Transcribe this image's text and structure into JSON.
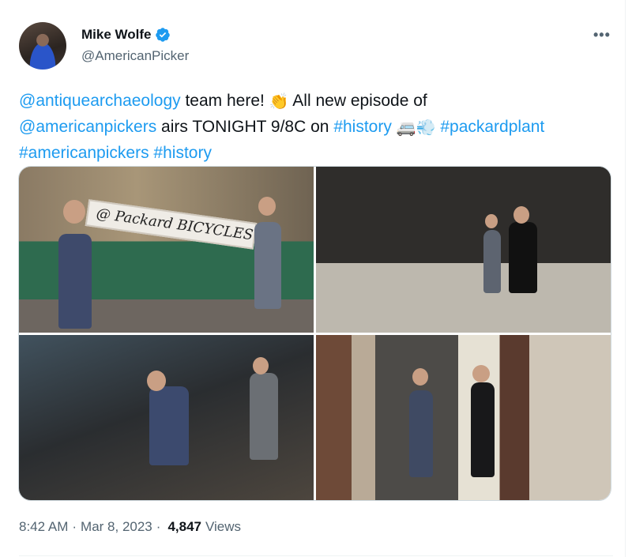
{
  "author": {
    "display_name": "Mike Wolfe",
    "handle": "@AmericanPicker",
    "verified": true
  },
  "menu": {
    "more_label": "•••"
  },
  "tweet": {
    "mention_team": "@antiquearchaeology",
    "text_part1": " team here! ",
    "emoji_clap": "👏",
    "text_part2": " All new episode of",
    "mention_show": "@americanpickers",
    "text_part3": " airs TONIGHT 9/8C on ",
    "hashtag_history": "#history",
    "emoji_bus": "🚐",
    "emoji_dash": "💨",
    "hashtag_packard": "#packardplant",
    "hashtag_pickers": "#americanpickers",
    "hashtag_history2": "#history"
  },
  "media": {
    "photos": [
      {
        "id": "packard-bicycles-sign",
        "sign_text": "@ Packard  BICYCLES"
      },
      {
        "id": "packard-plant-ruins"
      },
      {
        "id": "cluttered-room"
      },
      {
        "id": "doorway-brick-room"
      }
    ]
  },
  "meta": {
    "time": "8:42 AM",
    "sep1": "·",
    "date": "Mar 8, 2023",
    "sep2": "·",
    "views_count": "4,847",
    "views_label": "Views"
  },
  "colors": {
    "link": "#1d9bf0",
    "text": "#0f1419",
    "secondary": "#536471",
    "verified": "#1d9bf0"
  }
}
